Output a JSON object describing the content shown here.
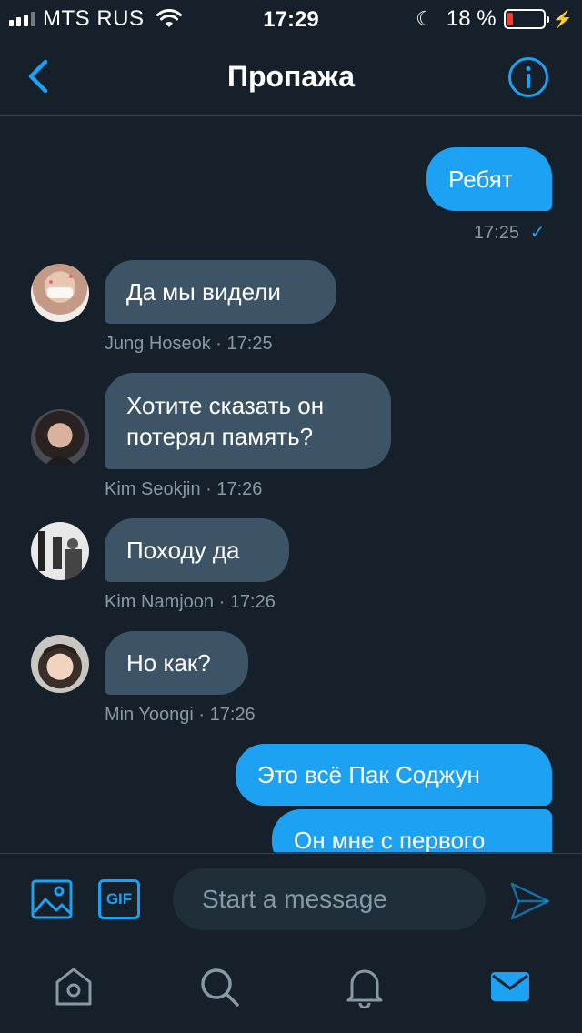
{
  "status_bar": {
    "carrier": "MTS RUS",
    "time": "17:29",
    "battery_percent": "18 %",
    "battery_level": 0.18
  },
  "header": {
    "title": "Пропажа"
  },
  "messages": [
    {
      "text": "Ребят",
      "meta": "17:25",
      "read_check": "✓"
    },
    {
      "text": "Да мы видели",
      "meta": "Jung Hoseok · 17:25"
    },
    {
      "line1": "Хотите сказать он",
      "line2": "потерял память?",
      "meta": "Kim Seokjin · 17:26"
    },
    {
      "text": "Походу да",
      "meta": "Kim Namjoon · 17:26"
    },
    {
      "text": "Но как?",
      "meta": "Min Yoongi · 17:26"
    },
    {
      "text": "Это всё Пак Соджун"
    },
    {
      "text": "Он мне с первого"
    }
  ],
  "composer": {
    "gif_label": "GIF",
    "placeholder": "Start a message"
  },
  "colors": {
    "background": "#15202b",
    "accent": "#1da1f2",
    "incoming_bubble": "#3d5466",
    "muted_text": "#8899a6"
  },
  "icons": [
    "back-chevron-icon",
    "info-icon",
    "image-icon",
    "gif-icon",
    "send-icon",
    "home-icon",
    "search-icon",
    "bell-icon",
    "mail-icon"
  ]
}
